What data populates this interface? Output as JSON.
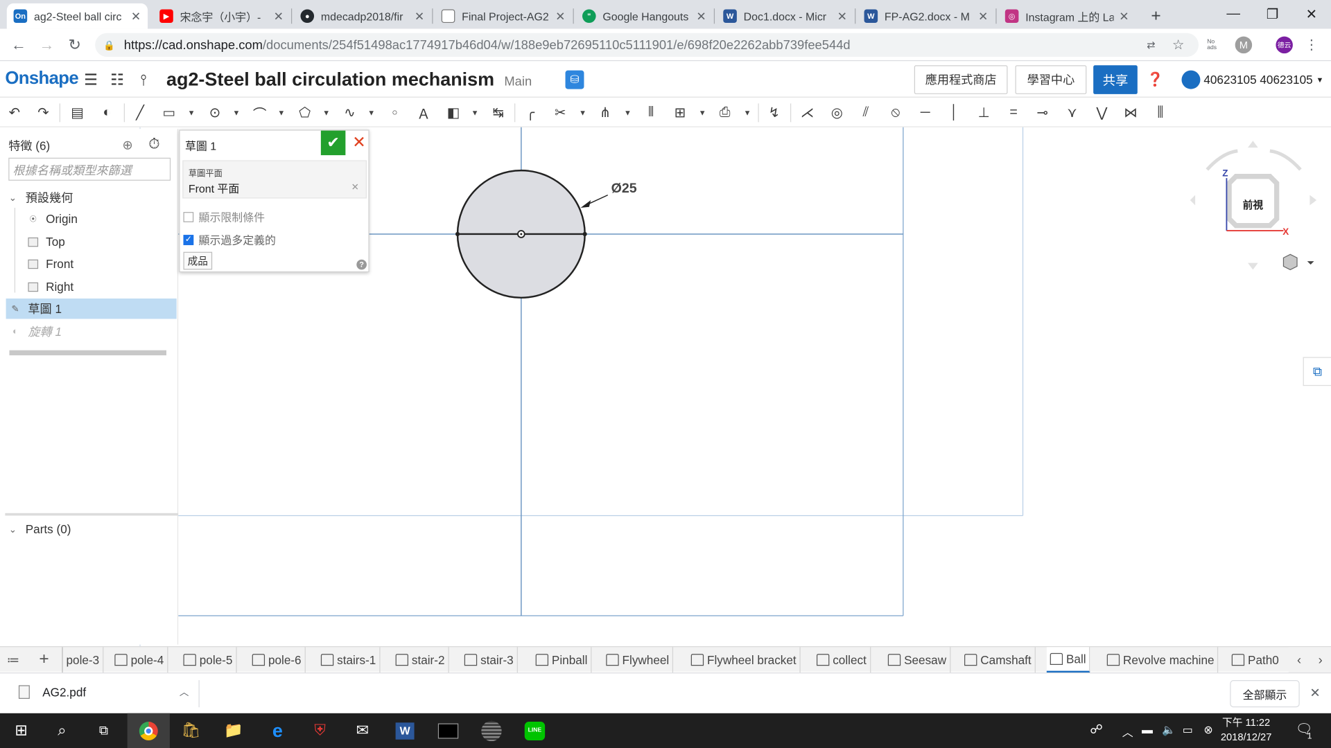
{
  "browser": {
    "tabs": [
      {
        "label": "ag2-Steel ball circ",
        "icon": "onshape-icon",
        "active": true
      },
      {
        "label": "宋念宇（小宇）-",
        "icon": "youtube-icon"
      },
      {
        "label": "mdecadp2018/fir",
        "icon": "github-icon"
      },
      {
        "label": "Final Project-AG2",
        "icon": "document-icon"
      },
      {
        "label": "Google Hangouts",
        "icon": "hangouts-icon"
      },
      {
        "label": "Doc1.docx - Micr",
        "icon": "word-icon"
      },
      {
        "label": "FP-AG2.docx - M",
        "icon": "word-icon"
      },
      {
        "label": "Instagram 上的 La",
        "icon": "instagram-icon"
      }
    ],
    "url_host": "https://cad.onshape.com",
    "url_path": "/documents/254f51498ac1774917b46d04/w/188e9eb72695110c5111901/e/698f20e2262abb739fee544d",
    "ext_noads": "No ads",
    "ext_m": "M",
    "profile": "德云"
  },
  "onshape": {
    "logo": "Onshape",
    "doc_title": "ag2-Steel ball circulation mechanism",
    "branch": "Main",
    "app_store": "應用程式商店",
    "learning": "學習中心",
    "share": "共享",
    "user": "40623105 40623105"
  },
  "tree": {
    "title": "特徵 (6)",
    "filter_placeholder": "根據名稱或類型來篩選",
    "default_geometry": "預設幾何",
    "items": [
      "Origin",
      "Top",
      "Front",
      "Right"
    ],
    "sketch": "草圖 1",
    "revolve": "旋轉 1",
    "parts": "Parts (0)"
  },
  "dialog": {
    "title": "草圖 1",
    "plane_label": "草圖平面",
    "plane_value": "Front 平面",
    "show_constraints": "顯示限制條件",
    "show_overdefined": "顯示過多定義的",
    "final": "成品"
  },
  "sketch": {
    "dimension": "Ø25"
  },
  "viewcube": {
    "face": "前視",
    "axis_z": "Z",
    "axis_x": "X"
  },
  "part_tabs": [
    "pole-3",
    "pole-4",
    "pole-5",
    "pole-6",
    "stairs-1",
    "stair-2",
    "stair-3",
    "Pinball",
    "Flywheel",
    "Flywheel bracket",
    "collect",
    "Seesaw",
    "Camshaft",
    "Ball",
    "Revolve machine",
    "Path0"
  ],
  "download": {
    "file": "AG2.pdf",
    "show_all": "全部顯示"
  },
  "taskbar": {
    "time": "下午 11:22",
    "date": "2018/12/27",
    "notif_count": "1"
  }
}
